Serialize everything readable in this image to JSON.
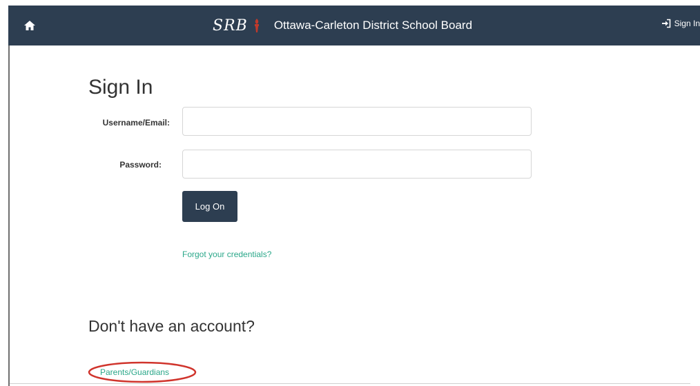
{
  "header": {
    "brand_logo": "SRB",
    "title": "Ottawa-Carleton District School Board",
    "signin_label": "Sign In"
  },
  "signin": {
    "title": "Sign In",
    "username_label": "Username/Email:",
    "username_value": "",
    "password_label": "Password:",
    "password_value": "",
    "logon_label": "Log On",
    "forgot_label": "Forgot your credentials?"
  },
  "register": {
    "title": "Don't have an account?",
    "parents_label": "Parents/Guardians"
  },
  "colors": {
    "navbar": "#2d3e51",
    "link": "#2aa789",
    "annotation": "#d0342c"
  }
}
